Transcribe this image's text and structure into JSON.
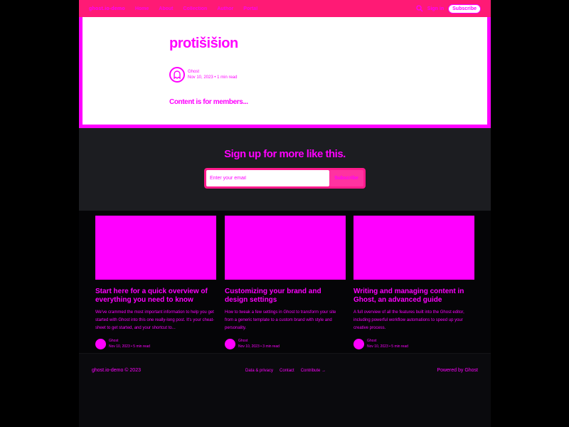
{
  "nav": {
    "brand": "ghost.io-demo",
    "links": [
      "Home",
      "About",
      "Collection",
      "Author",
      "Portal"
    ],
    "signin": "Sign in",
    "subscribe": "Subscribe"
  },
  "article": {
    "title": "protišišion",
    "author": "Ghost",
    "date_reading": "Nov 10, 2023 • 1 min read",
    "lock_text": "Content is for members..."
  },
  "signup": {
    "heading": "Sign up for more like this.",
    "email_placeholder": "Enter your email",
    "button": "Subscribe"
  },
  "cards": [
    {
      "title": "Start here for a quick overview of everything you need to know",
      "excerpt": "We've crammed the most important information to help you get started with Ghost into this one really-long post. It's your cheat-sheet to get started, and your shortcut to...",
      "author": "Ghost",
      "meta": "Nov 10, 2023 • 5 min read"
    },
    {
      "title": "Customizing your brand and design settings",
      "excerpt": "How to tweak a few settings in Ghost to transform your site from a generic template to a custom brand with style and personality.",
      "author": "Ghost",
      "meta": "Nov 10, 2023 • 3 min read"
    },
    {
      "title": "Writing and managing content in Ghost, an advanced guide",
      "excerpt": "A full overview of all the features built into the Ghost editor, including powerful workflow automations to speed up your creative process.",
      "author": "Ghost",
      "meta": "Nov 10, 2023 • 5 min read"
    }
  ],
  "footer": {
    "copyright": "ghost.io-demo © 2023",
    "links": [
      "Data & privacy",
      "Contact",
      "Contribute →"
    ],
    "powered": "Powered by Ghost"
  },
  "colors": {
    "accent": "#ff1a75",
    "magenta": "#ff00ff",
    "dark": "#1c1d21"
  }
}
